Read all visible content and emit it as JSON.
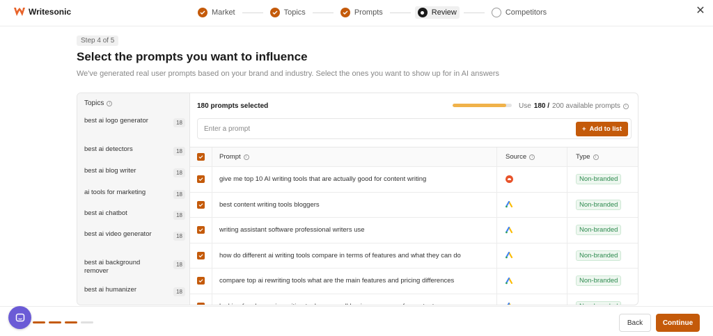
{
  "app": {
    "name": "Writesonic",
    "accent": "#c45a0a"
  },
  "stepper": {
    "steps": [
      {
        "label": "Market",
        "state": "done"
      },
      {
        "label": "Topics",
        "state": "done"
      },
      {
        "label": "Prompts",
        "state": "done"
      },
      {
        "label": "Review",
        "state": "active"
      },
      {
        "label": "Competitors",
        "state": "pending"
      }
    ]
  },
  "intro": {
    "step_badge": "Step 4 of 5",
    "title": "Select the prompts you want to influence",
    "subtitle": "We've generated real user prompts based on your brand and industry. Select the ones you want to show up for in AI answers"
  },
  "sidebar": {
    "header": "Topics",
    "items": [
      {
        "label": "best ai logo generator",
        "count": "18"
      },
      {
        "label": "best ai detectors",
        "count": "18"
      },
      {
        "label": "best ai blog writer",
        "count": "18"
      },
      {
        "label": "ai tools for marketing",
        "count": "18"
      },
      {
        "label": "best ai chatbot",
        "count": "18"
      },
      {
        "label": "best ai video generator",
        "count": "18"
      },
      {
        "label": "best ai background remover",
        "count": "18"
      },
      {
        "label": "best ai humanizer",
        "count": "18"
      }
    ]
  },
  "summary": {
    "selected_label": "180 prompts selected",
    "use_label": "Use",
    "used_value": "180 /",
    "available_label": "200 available prompts",
    "usage_fraction": 0.9
  },
  "prompt_input": {
    "placeholder": "Enter a prompt",
    "value": ""
  },
  "add_button": {
    "label": "Add to list"
  },
  "table": {
    "headers": {
      "prompt": "Prompt",
      "source": "Source",
      "type": "Type"
    },
    "rows": [
      {
        "prompt": "give me top 10 AI writing tools that are actually good for content writing",
        "source": "reddit",
        "type": "Non-branded",
        "checked": true
      },
      {
        "prompt": "best content writing tools bloggers",
        "source": "google-ads",
        "type": "Non-branded",
        "checked": true
      },
      {
        "prompt": "writing assistant software professional writers use",
        "source": "google-ads",
        "type": "Non-branded",
        "checked": true
      },
      {
        "prompt": "how do different ai writing tools compare in terms of features and what they can do",
        "source": "google-ads",
        "type": "Non-branded",
        "checked": true
      },
      {
        "prompt": "compare top ai rewriting tools what are the main features and pricing differences",
        "source": "google-ads",
        "type": "Non-branded",
        "checked": true
      },
      {
        "prompt": "looking for cheap ai rewriting tools our small business can use for content",
        "source": "google-ads",
        "type": "Non-branded",
        "checked": true
      }
    ]
  },
  "footer": {
    "back_label": "Back",
    "continue_label": "Continue",
    "progress_dashes": [
      true,
      true,
      true,
      false
    ]
  }
}
